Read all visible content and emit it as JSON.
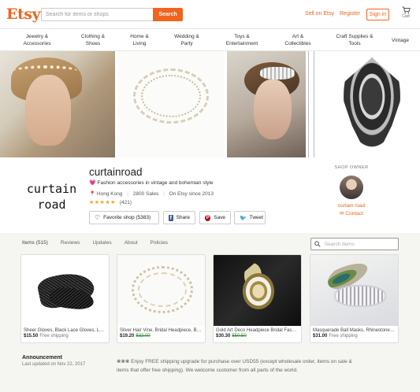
{
  "header": {
    "logo": "Etsy",
    "search_placeholder": "Search for items or shops",
    "search_button": "Search",
    "sell_on_etsy": "Sell on Etsy",
    "register": "Register",
    "sign_in": "Sign in",
    "cart": "Cart",
    "accent_color": "#f1641e"
  },
  "categories": [
    {
      "line1": "Jewelry &",
      "line2": "Accessories"
    },
    {
      "line1": "Clothing &",
      "line2": "Shoes"
    },
    {
      "line1": "Home &",
      "line2": "Living"
    },
    {
      "line1": "Wedding &",
      "line2": "Party"
    },
    {
      "line1": "Toys &",
      "line2": "Entertainment"
    },
    {
      "line1": "Art &",
      "line2": "Collectibles"
    },
    {
      "line1": "Craft Supplies &",
      "line2": "Tools"
    },
    {
      "line1": "Vintage",
      "line2": ""
    }
  ],
  "shop": {
    "logo_line1": "curtain",
    "logo_line2": "road",
    "name": "curtainroad",
    "tagline": "Fashion accessories in vintage and bohemian style",
    "location": "Hong Kong",
    "sales": "2800 Sales",
    "since": "On Etsy since 2013",
    "stars": "★★★★★",
    "review_count": "(421)",
    "favorite_label": "Favorite shop (5383)",
    "share_label": "Share",
    "save_label": "Save",
    "tweet_label": "Tweet"
  },
  "owner": {
    "heading": "SHOP OWNER",
    "name": "curtain road",
    "contact": "Contact"
  },
  "tabs": [
    {
      "label": "Items (515)"
    },
    {
      "label": "Reviews"
    },
    {
      "label": "Updates"
    },
    {
      "label": "About"
    },
    {
      "label": "Policies"
    }
  ],
  "shop_search_placeholder": "Search items",
  "listings": [
    {
      "title": "Sheer Gloves, Black Lace Gloves, Lac...",
      "price": "$15.50",
      "original": "",
      "shipping": "Free shipping"
    },
    {
      "title": "Silver Hair Vine, Bridal Headpiece, Bo...",
      "price": "$19.20",
      "original": "$32.00",
      "shipping": ""
    },
    {
      "title": "Gold Art Deco Headpiece Bridal Fasci...",
      "price": "$30.30",
      "original": "$50.50",
      "shipping": ""
    },
    {
      "title": "Masquerade Ball Masks, Rhinestone F...",
      "price": "$31.00",
      "original": "",
      "shipping": "Free shipping"
    }
  ],
  "announcement": {
    "heading": "Announcement",
    "date": "Last updated on Nov 22, 2017",
    "text": "❀❀❀ Enjoy FREE shipping upgrade for purchase over USD55 (except wholesale order, items on sale & items that offer free shipping). We welcome customer from all parts of the world."
  }
}
